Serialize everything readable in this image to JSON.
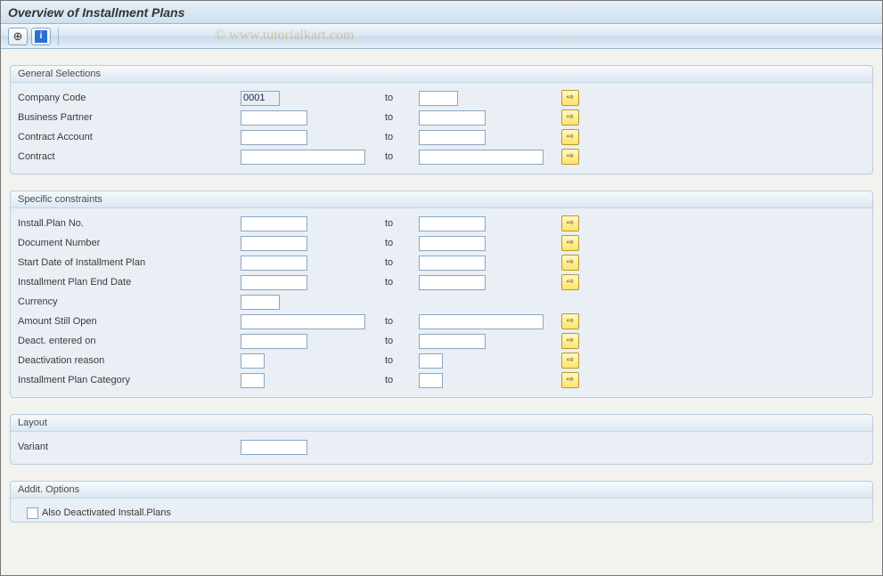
{
  "title": "Overview of Installment Plans",
  "watermark": "© www.tutorialkart.com",
  "labels": {
    "to_text": "to"
  },
  "group1": {
    "title": "General Selections",
    "rows": {
      "company_code": {
        "label": "Company Code",
        "low": "0001",
        "high": ""
      },
      "business_partner": {
        "label": "Business Partner",
        "low": "",
        "high": ""
      },
      "contract_account": {
        "label": "Contract Account",
        "low": "",
        "high": ""
      },
      "contract": {
        "label": "Contract",
        "low": "",
        "high": ""
      }
    }
  },
  "group2": {
    "title": "Specific constraints",
    "rows": {
      "plan_no": {
        "label": "Install.Plan No.",
        "low": "",
        "high": ""
      },
      "doc_no": {
        "label": "Document Number",
        "low": "",
        "high": ""
      },
      "start_date": {
        "label": "Start Date of Installment Plan",
        "low": "",
        "high": ""
      },
      "end_date": {
        "label": "Installment Plan End Date",
        "low": "",
        "high": ""
      },
      "currency": {
        "label": "Currency",
        "low": ""
      },
      "amt_open": {
        "label": "Amount Still Open",
        "low": "",
        "high": ""
      },
      "deact_on": {
        "label": "Deact. entered on",
        "low": "",
        "high": ""
      },
      "deact_rsn": {
        "label": "Deactivation reason",
        "low": "",
        "high": ""
      },
      "category": {
        "label": "Installment Plan Category",
        "low": "",
        "high": ""
      }
    }
  },
  "group3": {
    "title": "Layout",
    "variant_label": "Variant",
    "variant_value": ""
  },
  "group4": {
    "title": "Addit. Options",
    "also_deactivated_label": "Also Deactivated Install.Plans",
    "also_deactivated_checked": false
  }
}
